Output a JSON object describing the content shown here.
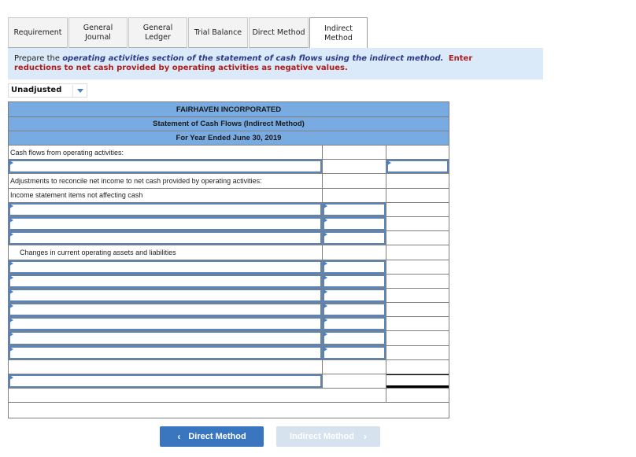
{
  "tabs": [
    {
      "label": "Requirement",
      "active": false
    },
    {
      "label": "General\nJournal",
      "active": false
    },
    {
      "label": "General\nLedger",
      "active": false
    },
    {
      "label": "Trial Balance",
      "active": false
    },
    {
      "label": "Direct Method",
      "active": false
    },
    {
      "label": "Indirect\nMethod",
      "active": true
    }
  ],
  "instruction": {
    "prefix": "Prepare the ",
    "italic": "operating activities section of the statement of cash flows using the indirect method.",
    "red_line1": "Enter",
    "red_line2": "reductions to net cash provided by operating activities as negative values."
  },
  "dropdown": {
    "selected": "Unadjusted"
  },
  "statement": {
    "company": "FAIRHAVEN INCORPORATED",
    "title": "Statement of Cash Flows (Indirect Method)",
    "period": "For Year Ended June 30, 2019",
    "labels": {
      "cash_flows_operating": "Cash flows from operating activities:",
      "adjustments": "Adjustments to reconcile net income to net cash provided by operating activities:",
      "income_items": "Income statement items not affecting cash",
      "changes_current": "Changes in current operating assets and liabilities"
    },
    "inputs": {
      "net_income_label": "",
      "net_income_value": "",
      "noncash_items": [
        {
          "label": "",
          "value": ""
        },
        {
          "label": "",
          "value": ""
        },
        {
          "label": "",
          "value": ""
        }
      ],
      "changes_items": [
        {
          "label": "",
          "value": ""
        },
        {
          "label": "",
          "value": ""
        },
        {
          "label": "",
          "value": ""
        },
        {
          "label": "",
          "value": ""
        },
        {
          "label": "",
          "value": ""
        },
        {
          "label": "",
          "value": ""
        },
        {
          "label": "",
          "value": ""
        }
      ],
      "total_label": ""
    }
  },
  "buttons": {
    "prev_label": "Direct Method",
    "next_label": "Indirect Method",
    "prev_icon": "chevron-left-icon",
    "next_icon": "chevron-right-icon"
  },
  "colors": {
    "header_bg": "#79abe3",
    "instruction_bg": "#dbeaf8",
    "primary_button": "#3a76bf",
    "disabled_button": "#d7e2ef",
    "instruction_red": "#b01b1b",
    "instruction_italic": "#2c3a8a"
  }
}
